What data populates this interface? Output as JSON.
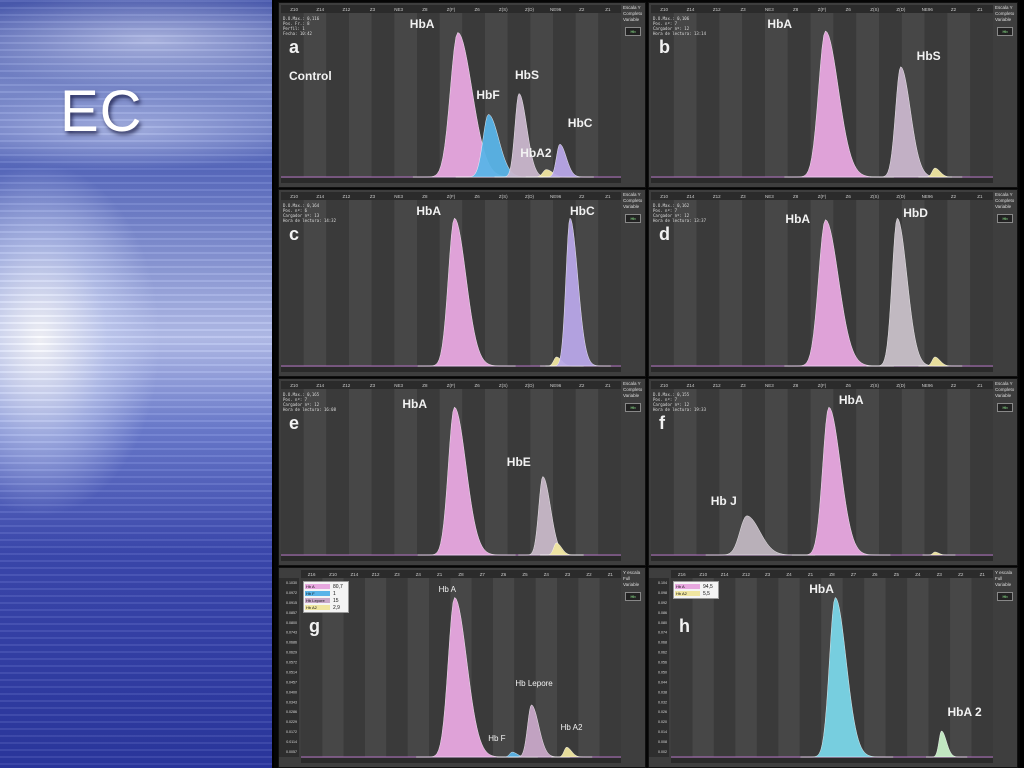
{
  "slide": {
    "title": "EC",
    "colors": {
      "hba": "#e8a8e0",
      "hbf": "#5ab4e8",
      "variant": "#c9b6cc",
      "hba2": "#f0e6a0",
      "hbc": "#b8a6e8",
      "hbd": "#c8c0c8",
      "hbe": "#c8b8c8",
      "hbj": "#c0b6c0",
      "lepore": "#c8a8c8",
      "h_trace": "#7ad6e8"
    }
  },
  "panels": [
    {
      "id": "a",
      "letter": "a",
      "extra_label": "Control",
      "meta": [
        "D.O.Max.: 0,116",
        "Pos. Fr.: 8",
        "Perfil: 1",
        "Fecha: 10:42"
      ],
      "peaks": [
        {
          "label": "HbA",
          "x": 0.52,
          "h": 0.97,
          "w": 0.022,
          "color": "#e8a8e0"
        },
        {
          "label": "HbF",
          "x": 0.61,
          "h": 0.42,
          "w": 0.016,
          "color": "#5ab4e8"
        },
        {
          "label": "HbS",
          "x": 0.7,
          "h": 0.56,
          "w": 0.012,
          "color": "#c9b6cc"
        },
        {
          "label": "HbA2",
          "x": 0.78,
          "h": 0.05,
          "w": 0.01,
          "color": "#f0e6a0"
        },
        {
          "label": "HbC",
          "x": 0.82,
          "h": 0.22,
          "w": 0.01,
          "color": "#b8a6e8"
        }
      ],
      "top_ticks": [
        "Z10",
        "Z14",
        "Z12",
        "Z3",
        "NE3",
        "Z8",
        "Z(F)",
        "Z6",
        "Z(S)",
        "Z(D)",
        "NE96",
        "Z2",
        "Z1"
      ],
      "side": [
        "Escala Y",
        "Completo",
        "Variable"
      ]
    },
    {
      "id": "b",
      "letter": "b",
      "meta": [
        "D.O.Max.: 0,106",
        "Pos. nº: 7",
        "Cargador nº: 12",
        "Hora de lectura: 13:14"
      ],
      "peaks": [
        {
          "label": "HbA",
          "x": 0.51,
          "h": 0.98,
          "w": 0.02,
          "color": "#e8a8e0"
        },
        {
          "label": "HbS",
          "x": 0.73,
          "h": 0.74,
          "w": 0.015,
          "color": "#c9b6cc"
        },
        {
          "label": "",
          "x": 0.83,
          "h": 0.06,
          "w": 0.008,
          "color": "#f0e6a0"
        }
      ],
      "side": [
        "Escala Y",
        "Completo",
        "Variable"
      ]
    },
    {
      "id": "c",
      "letter": "c",
      "meta": [
        "D.O.Max.: 0,164",
        "Pos. nº: 6",
        "Cargador nº: 13",
        "Hora de lectura: 14:32"
      ],
      "peaks": [
        {
          "label": "HbA",
          "x": 0.51,
          "h": 0.98,
          "w": 0.018,
          "color": "#e8a8e0"
        },
        {
          "label": "",
          "x": 0.81,
          "h": 0.06,
          "w": 0.008,
          "color": "#f0e6a0"
        },
        {
          "label": "HbC",
          "x": 0.85,
          "h": 0.98,
          "w": 0.012,
          "color": "#b8a6e8"
        }
      ],
      "side": [
        "Escala Y",
        "Completo",
        "Variable"
      ]
    },
    {
      "id": "d",
      "letter": "d",
      "meta": [
        "D.O.Max.: 0,162",
        "Pos. nº: 7",
        "Cargador nº: 12",
        "Hora de lectura: 13:37"
      ],
      "peaks": [
        {
          "label": "HbA",
          "x": 0.51,
          "h": 0.97,
          "w": 0.02,
          "color": "#e8a8e0"
        },
        {
          "label": "HbD",
          "x": 0.72,
          "h": 0.98,
          "w": 0.015,
          "color": "#c8c0c8"
        },
        {
          "label": "",
          "x": 0.83,
          "h": 0.06,
          "w": 0.008,
          "color": "#f0e6a0"
        }
      ],
      "side": [
        "Escala Y",
        "Completo",
        "Variable"
      ]
    },
    {
      "id": "e",
      "letter": "e",
      "meta": [
        "D.O.Max.: 0,165",
        "Pos. nº: 7",
        "Cargador nº: 12",
        "Hora de lectura: 16:08"
      ],
      "peaks": [
        {
          "label": "HbA",
          "x": 0.51,
          "h": 0.98,
          "w": 0.018,
          "color": "#e8a8e0"
        },
        {
          "label": "HbE",
          "x": 0.77,
          "h": 0.52,
          "w": 0.012,
          "color": "#c8b8c8"
        },
        {
          "label": "",
          "x": 0.81,
          "h": 0.08,
          "w": 0.008,
          "color": "#f0e6a0"
        }
      ],
      "side": [
        "Escala Y",
        "Completo",
        "Variable"
      ]
    },
    {
      "id": "f",
      "letter": "f",
      "meta": [
        "D.O.Max.: 0,155",
        "Pos. nº: 7",
        "Cargador nº: 12",
        "Hora de lectura: 19:33"
      ],
      "peaks": [
        {
          "label": "Hb J",
          "x": 0.28,
          "h": 0.26,
          "w": 0.02,
          "color": "#c0b6c0"
        },
        {
          "label": "HbA",
          "x": 0.52,
          "h": 0.98,
          "w": 0.018,
          "color": "#e8a8e0"
        },
        {
          "label": "",
          "x": 0.83,
          "h": 0.02,
          "w": 0.006,
          "color": "#f0e6a0"
        }
      ],
      "side": [
        "Escala Y",
        "Completo",
        "Variable"
      ]
    },
    {
      "id": "g",
      "letter": "g",
      "legend": [
        {
          "name": "Hb A",
          "value": "80,7",
          "color": "#e8a8e0"
        },
        {
          "name": "Hb F",
          "value": "1",
          "color": "#5ab4e8"
        },
        {
          "name": "Hb Lepore",
          "value": "15",
          "color": "#c8a8c8"
        },
        {
          "name": "Hb A2",
          "value": "2,9",
          "color": "#f0e6a0"
        }
      ],
      "yticks": [
        "0.1030",
        "0.0972",
        "0.0915",
        "0.0857",
        "0.0800",
        "0.0743",
        "0.0686",
        "0.0629",
        "0.0572",
        "0.0514",
        "0.0457",
        "0.0400",
        "0.0343",
        "0.0286",
        "0.0229",
        "0.0172",
        "0.0114",
        "0.0057"
      ],
      "peaks": [
        {
          "label": "Hb A",
          "x": 0.48,
          "h": 0.98,
          "w": 0.02,
          "color": "#e8a8e0"
        },
        {
          "label": "Hb F",
          "x": 0.66,
          "h": 0.03,
          "w": 0.008,
          "color": "#5ab4e8"
        },
        {
          "label": "Hb Lepore",
          "x": 0.72,
          "h": 0.32,
          "w": 0.012,
          "color": "#c8a8c8"
        },
        {
          "label": "Hb A2",
          "x": 0.83,
          "h": 0.06,
          "w": 0.008,
          "color": "#f0e6a0"
        }
      ],
      "top_ticks": [
        "Z16",
        "Z10",
        "Z14",
        "Z12",
        "Z3",
        "Z4",
        "Z1",
        "Z8",
        "Z7",
        "Z6",
        "Z5",
        "Z4",
        "Z3",
        "Z2",
        "Z1"
      ],
      "side": [
        "Y escala",
        "Full",
        "Variable"
      ]
    },
    {
      "id": "h",
      "letter": "h",
      "legend": [
        {
          "name": "Hb A",
          "value": "94,5",
          "color": "#e8a8e0"
        },
        {
          "name": "Hb A2",
          "value": "5,5",
          "color": "#f0e6a0"
        }
      ],
      "yticks": [
        "0.104",
        "0.098",
        "0.092",
        "0.086",
        "0.080",
        "0.074",
        "0.068",
        "0.062",
        "0.056",
        "0.050",
        "0.044",
        "0.038",
        "0.032",
        "0.026",
        "0.020",
        "0.014",
        "0.008",
        "0.002"
      ],
      "peaks": [
        {
          "label": "HbA",
          "x": 0.51,
          "h": 0.98,
          "w": 0.018,
          "color": "#7ad6e8"
        },
        {
          "label": "HbA 2",
          "x": 0.84,
          "h": 0.16,
          "w": 0.008,
          "color": "#c8f0c8"
        }
      ],
      "top_ticks": [
        "Z16",
        "Z10",
        "Z14",
        "Z12",
        "Z3",
        "Z4",
        "Z1",
        "Z8",
        "Z7",
        "Z6",
        "Z5",
        "Z4",
        "Z3",
        "Z2",
        "Z1"
      ],
      "side": [
        "Y escala",
        "Full",
        "Variable"
      ]
    }
  ]
}
